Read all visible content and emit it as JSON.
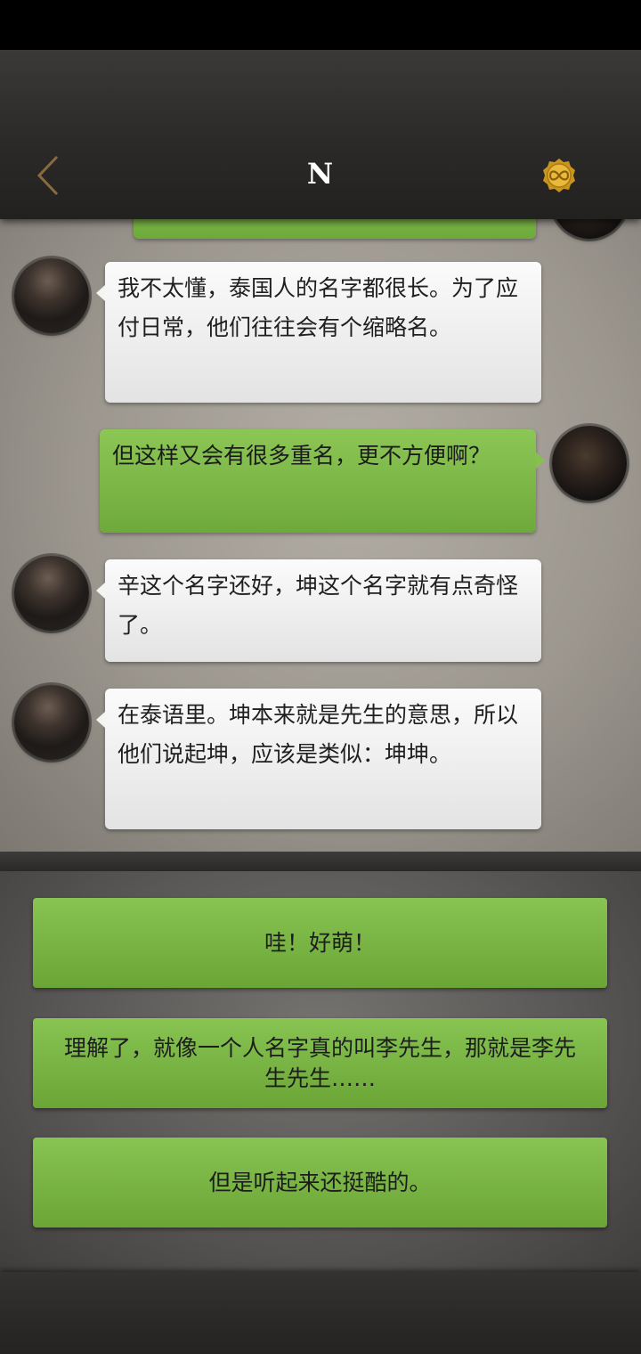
{
  "header": {
    "title": "N",
    "back_icon": "chevron-left-icon",
    "coin_icon": "infinity-coin-icon"
  },
  "colors": {
    "header_bg": "#2b2a28",
    "chat_bg": "#a9a49c",
    "outgoing_bubble": "#7cb946",
    "incoming_bubble": "#f2f2f2",
    "option_green": "#7ab744",
    "back_icon": "#8a6b3e",
    "coin_gold": "#d4a02a"
  },
  "messages": [
    {
      "side": "right",
      "text": ""
    },
    {
      "side": "left",
      "text": "我不太懂，泰国人的名字都很长。为了应付日常，他们往往会有个缩略名。"
    },
    {
      "side": "right",
      "text": "但这样又会有很多重名，更不方便啊？"
    },
    {
      "side": "left",
      "text": "辛这个名字还好，坤这个名字就有点奇怪了。"
    },
    {
      "side": "left",
      "text": "在泰语里。坤本来就是先生的意思，所以他们说起坤，应该是类似：坤坤。"
    }
  ],
  "options": [
    "哇！好萌！",
    "理解了，就像一个人名字真的叫李先生，那就是李先生先生……",
    "但是听起来还挺酷的。"
  ]
}
